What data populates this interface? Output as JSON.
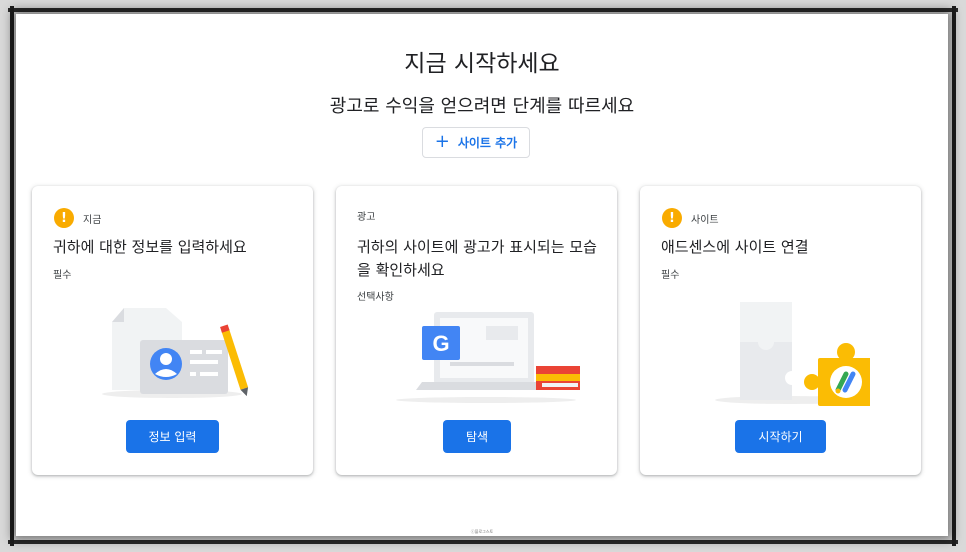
{
  "page": {
    "title": "지금 시작하세요",
    "subtitle": "광고로 수익을 얻으려면 단계를 따르세요",
    "add_site_label": "사이트 추가",
    "footer_mark": "ⓒ블로그스토"
  },
  "cards": [
    {
      "status_label": "지금",
      "title": "귀하에 대한 정보를 입력하세요",
      "requirement": "필수",
      "button_label": "정보 입력",
      "has_warning": true
    },
    {
      "status_label": "광고",
      "title": "귀하의 사이트에 광고가 표시되는 모습을 확인하세요",
      "requirement": "선택사항",
      "button_label": "탐색",
      "has_warning": false
    },
    {
      "status_label": "사이트",
      "title": "애드센스에 사이트 연결",
      "requirement": "필수",
      "button_label": "시작하기",
      "has_warning": true
    }
  ],
  "icons": {
    "warning": "warning-icon",
    "add": "plus-icon"
  },
  "colors": {
    "primary": "#1a73e8",
    "warning": "#f9ab00",
    "text": "#202124"
  }
}
